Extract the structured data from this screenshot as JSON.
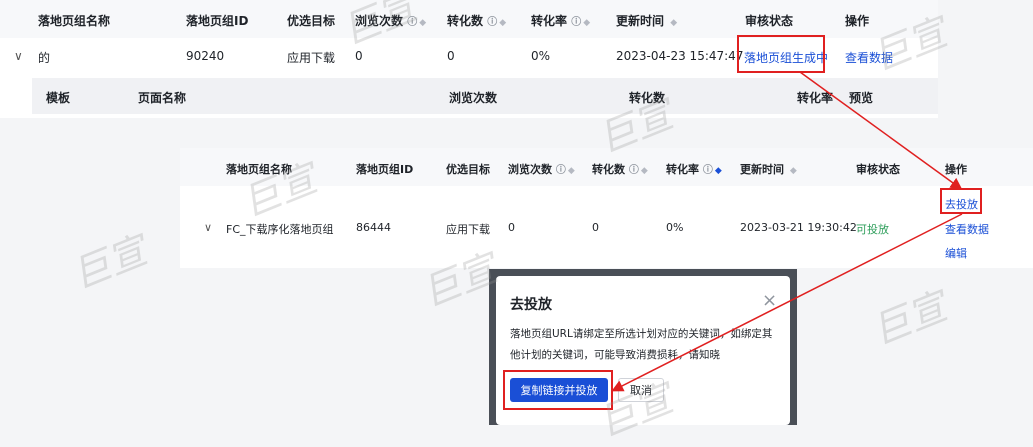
{
  "top_table": {
    "headers": {
      "name": "落地页组名称",
      "id": "落地页组ID",
      "goal": "优选目标",
      "views": "浏览次数",
      "conversions": "转化数",
      "rate": "转化率",
      "updated": "更新时间",
      "status": "审核状态",
      "actions": "操作"
    },
    "row": {
      "expand_glyph": "∨",
      "name": "的",
      "id": "90240",
      "goal": "应用下载",
      "views": "0",
      "conversions": "0",
      "rate": "0%",
      "updated": "2023-04-23 15:47:47",
      "status": "落地页组生成中",
      "action": "查看数据"
    },
    "sub_headers": {
      "template": "模板",
      "page_name": "页面名称",
      "views": "浏览次数",
      "conversions": "转化数",
      "rate": "转化率",
      "preview": "预览"
    }
  },
  "second_table": {
    "headers": {
      "name": "落地页组名称",
      "id": "落地页组ID",
      "goal": "优选目标",
      "views": "浏览次数",
      "conversions": "转化数",
      "rate": "转化率",
      "updated": "更新时间",
      "status": "审核状态",
      "actions": "操作"
    },
    "row": {
      "expand_glyph": "∨",
      "name": "FC_下载序化落地页组",
      "id": "86444",
      "goal": "应用下载",
      "views": "0",
      "conversions": "0",
      "rate": "0%",
      "updated": "2023-03-21 19:30:42",
      "status": "可投放",
      "actions": [
        "去投放",
        "查看数据",
        "编辑"
      ]
    }
  },
  "dialog": {
    "title": "去投放",
    "close_glyph": "×",
    "body_line1": "落地页组URL请绑定至所选计划对应的关键词，如绑定其",
    "body_line2": "他计划的关键词，可能导致消费损耗，请知晓",
    "confirm": "复制链接并投放",
    "cancel": "取消"
  },
  "icons": {
    "help": "?",
    "sort": "⇕"
  },
  "watermark": "巨宣",
  "colors": {
    "link": "#1a4fd6",
    "highlight": "#e02020",
    "status_ok": "#2e9e5b"
  }
}
